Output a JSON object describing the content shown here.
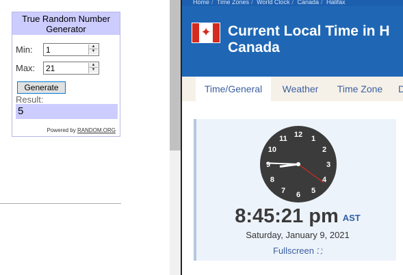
{
  "widget": {
    "title": "True Random Number Generator",
    "min_label": "Min:",
    "min_value": "1",
    "max_label": "Max:",
    "max_value": "21",
    "generate_label": "Generate",
    "result_label": "Result:",
    "result_value": "5",
    "powered_prefix": "Powered by",
    "powered_link": "RANDOM.ORG"
  },
  "site": {
    "breadcrumbs": [
      "Home",
      "Time Zones",
      "World Clock",
      "Canada",
      "Halifax"
    ],
    "title_line1": "Current Local Time in H",
    "title_line2": "Canada",
    "tabs": [
      "Time/General",
      "Weather",
      "Time Zone",
      "D"
    ],
    "active_tab": "Time/General",
    "time": "8:45:21 pm",
    "timezone": "AST",
    "date": "Saturday, January 9, 2021",
    "fullscreen_label": "Fullscreen",
    "clock": {
      "hour": 8,
      "minute": 45,
      "second": 21,
      "numbers": [
        "12",
        "1",
        "2",
        "3",
        "4",
        "5",
        "6",
        "7",
        "8",
        "9",
        "10",
        "11"
      ],
      "face_color": "#3b3b3b",
      "hand_color": "#ffffff",
      "second_hand_color": "#d52b1e"
    }
  },
  "colors": {
    "header_blue": "#1f67b5",
    "widget_accent": "#ccccff",
    "canada_red": "#d52b1e"
  }
}
